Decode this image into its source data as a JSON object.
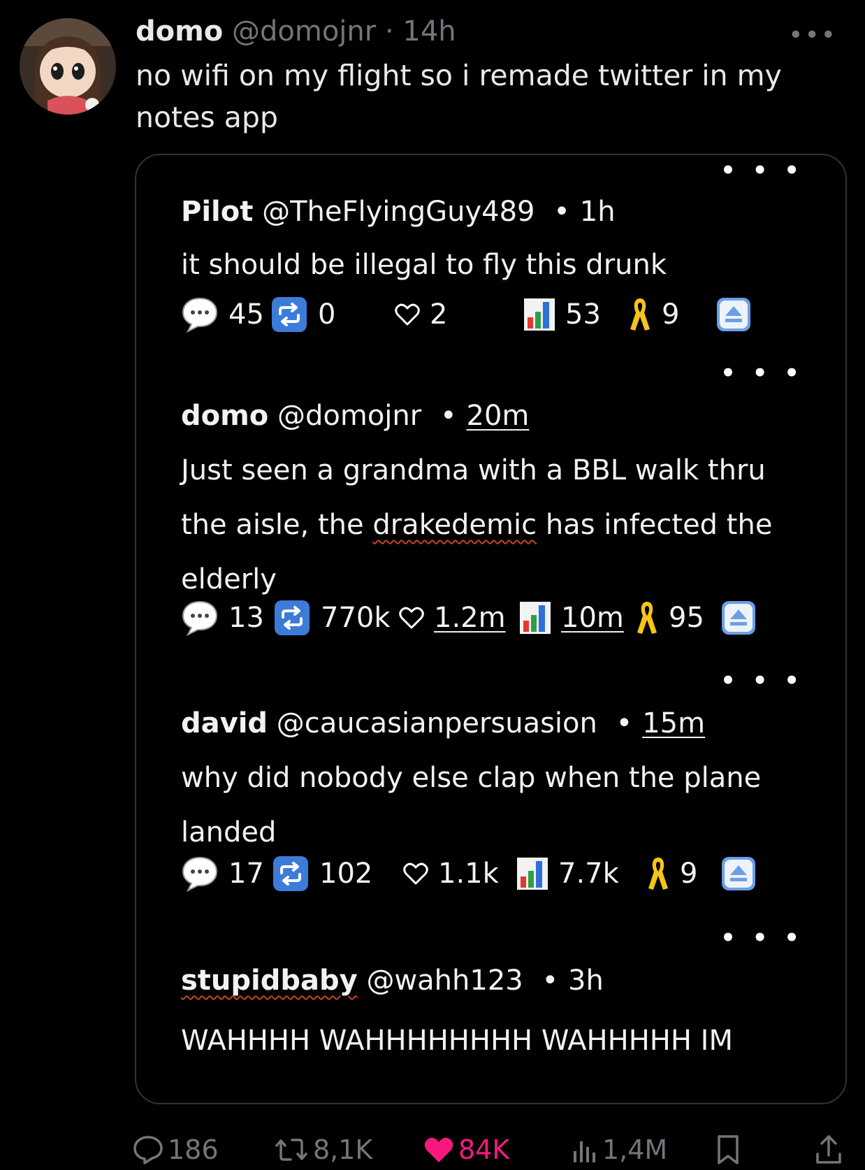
{
  "outer": {
    "name": "domo",
    "handle": "@domojnr",
    "dot": "·",
    "time": "14h",
    "more": "•••",
    "text": "no wifi on my flight so i remade twitter in my notes app"
  },
  "card": {
    "posts": [
      {
        "more": "• • •",
        "name": "Pilot",
        "handle": "@TheFlyingGuy489",
        "sep": "•",
        "time": "1h",
        "text": "it should be illegal to fly this drunk",
        "replies": "45",
        "reposts": "0",
        "likes": "2",
        "views": "53",
        "ribbons": "9"
      },
      {
        "more": "• • •",
        "name": "domo",
        "handle": "@domojnr",
        "sep": "•",
        "time": "20m",
        "text_a": "Just seen a grandma with a BBL walk thru the aisle, the ",
        "text_b": "drakedemic",
        "text_c": " has infected the elderly",
        "replies": "13",
        "reposts": "770k",
        "likes": "1.2m",
        "views": "10m",
        "ribbons": "95"
      },
      {
        "more": "• • •",
        "name": "david",
        "handle": "@caucasianpersuasion",
        "sep": "•",
        "time": "15m",
        "text": "why did nobody else clap when the plane landed",
        "replies": "17",
        "reposts": "102",
        "likes": "1.1k",
        "views": "7.7k",
        "ribbons": "9"
      },
      {
        "name": "stupidbaby",
        "handle": "@wahh123",
        "sep": "•",
        "time": "3h",
        "text": "WAHHHH WAHHHHHHHH WAHHHHH IM"
      }
    ]
  },
  "actions": {
    "replies": "186",
    "reposts": "8,1K",
    "likes": "84K",
    "views": "1,4M"
  },
  "colors": {
    "like_pink": "#f91880",
    "ribbon_gold": "#f5c518",
    "repost_blue": "#3d7bd9",
    "muted": "#71767b"
  }
}
